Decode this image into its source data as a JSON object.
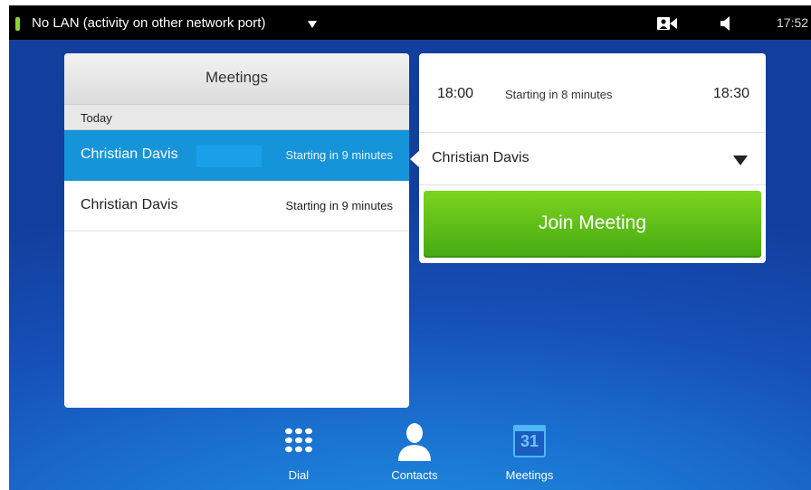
{
  "status_bar": {
    "network_text": "No LAN (activity on other network port)",
    "time": "17:52",
    "icons": [
      "camera-icon",
      "speaker-icon"
    ]
  },
  "meetings_panel": {
    "title": "Meetings",
    "section": "Today",
    "items": [
      {
        "name": "Christian Davis",
        "status": "Starting in 9 minutes",
        "selected": true
      },
      {
        "name": "Christian Davis",
        "status": "Starting in 9 minutes",
        "selected": false
      }
    ]
  },
  "detail": {
    "start": "18:00",
    "relative": "Starting in 8 minutes",
    "end": "18:30",
    "organizer": "Christian Davis",
    "join_label": "Join Meeting"
  },
  "nav": {
    "items": [
      {
        "label": "Dial",
        "icon": "dialpad-icon"
      },
      {
        "label": "Contacts",
        "icon": "person-icon"
      },
      {
        "label": "Meetings",
        "icon": "calendar-icon",
        "icon_text": "31"
      }
    ]
  },
  "colors": {
    "accent": "#1694da",
    "join_green": "#5cbf16",
    "status_led": "#8bd62c"
  }
}
